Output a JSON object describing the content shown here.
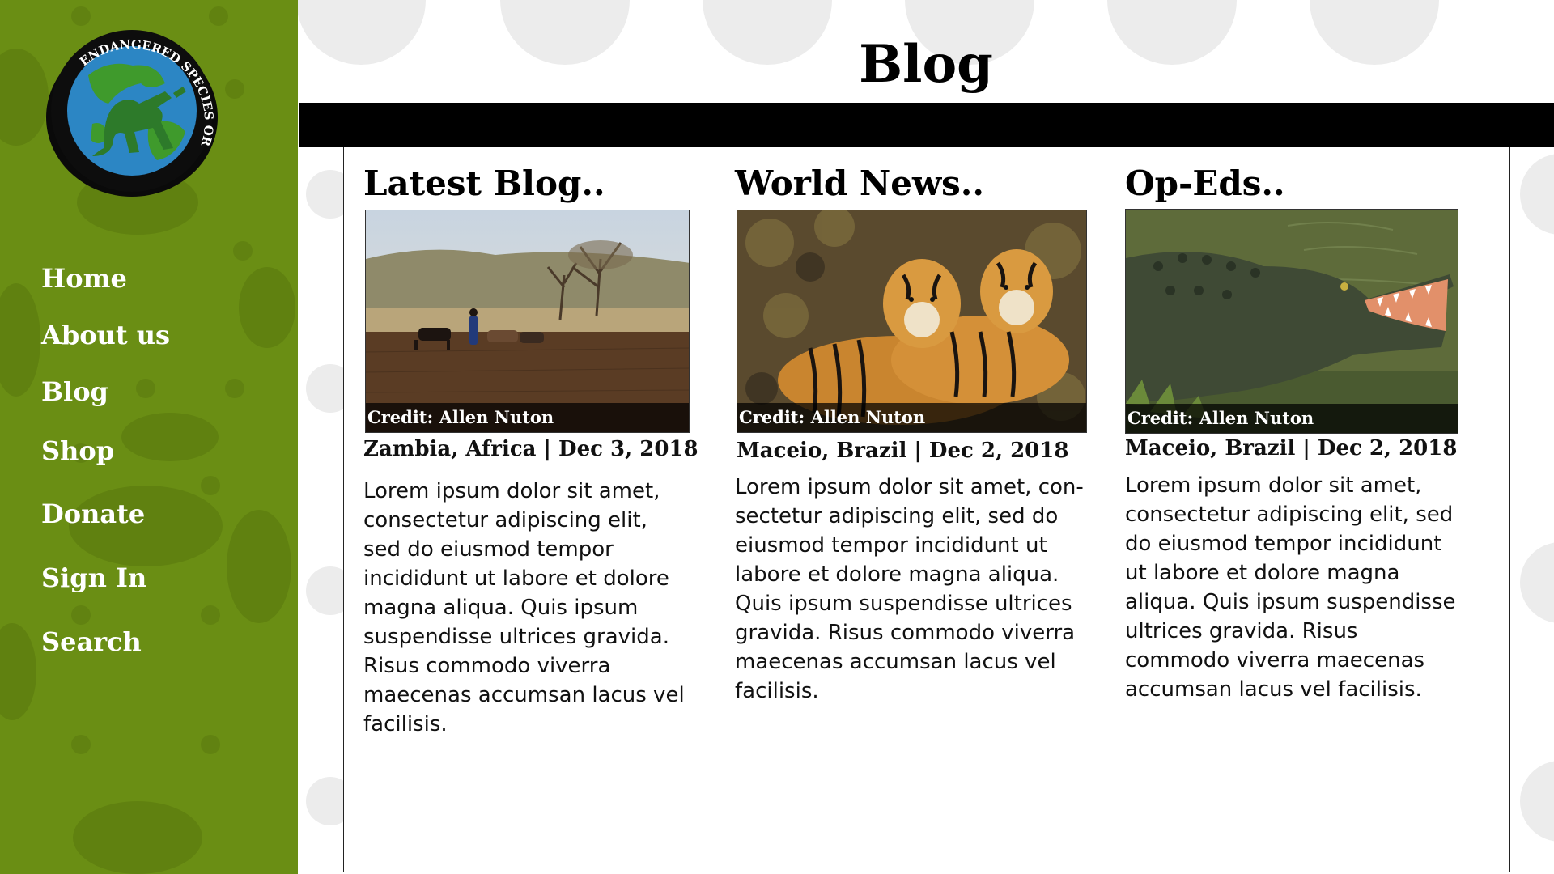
{
  "brand": {
    "logo_text": "ENDANGERED SPECIES ORGANIZATION",
    "logo_icon": "monkey-globe-logo",
    "sidebar_color": "#6a8e14"
  },
  "nav": {
    "items": [
      {
        "label": "Home"
      },
      {
        "label": "About us"
      },
      {
        "label": "Blog"
      },
      {
        "label": "Shop"
      },
      {
        "label": "Donate"
      },
      {
        "label": "Sign In"
      },
      {
        "label": "Search"
      }
    ]
  },
  "page": {
    "title": "Blog"
  },
  "columns": [
    {
      "heading": "Latest Blog..",
      "image": "savanna-cattle-herder-photo",
      "credit": "Credit: Allen Nuton",
      "meta": "Zambia, Africa  |  Dec 3, 2018",
      "body": "Lorem ipsum dolor sit amet, consectetur adipiscing elit, sed do eiusmod tempor incididunt ut labore et dolore magna aliqua. Quis ipsum suspendisse ultrices gravida. Risus commodo viverra maecenas accumsan lacus vel facilisis."
    },
    {
      "heading": "World News..",
      "image": "two-tigers-photo",
      "credit": "Credit: Allen Nuton",
      "meta": "Maceio, Brazil | Dec 2, 2018",
      "body": "Lorem ipsum dolor sit amet, con-sectetur adipiscing elit, sed do eiusmod tempor incididunt ut labore et dolore magna aliqua. Quis ipsum suspendisse ultrices gravida. Risus commodo viverra maecenas accumsan lacus vel facilisis."
    },
    {
      "heading": "Op-Eds..",
      "image": "crocodile-photo",
      "credit": "Credit: Allen Nuton",
      "meta": "Maceio, Brazil | Dec 2, 2018",
      "body": "Lorem ipsum dolor sit amet, consectetur adipiscing elit, sed do eiusmod tempor incididunt ut labore et dolore magna aliqua. Quis ipsum suspendisse ultrices gravida. Risus commodo viverra maecenas accumsan lacus vel facilisis."
    }
  ]
}
